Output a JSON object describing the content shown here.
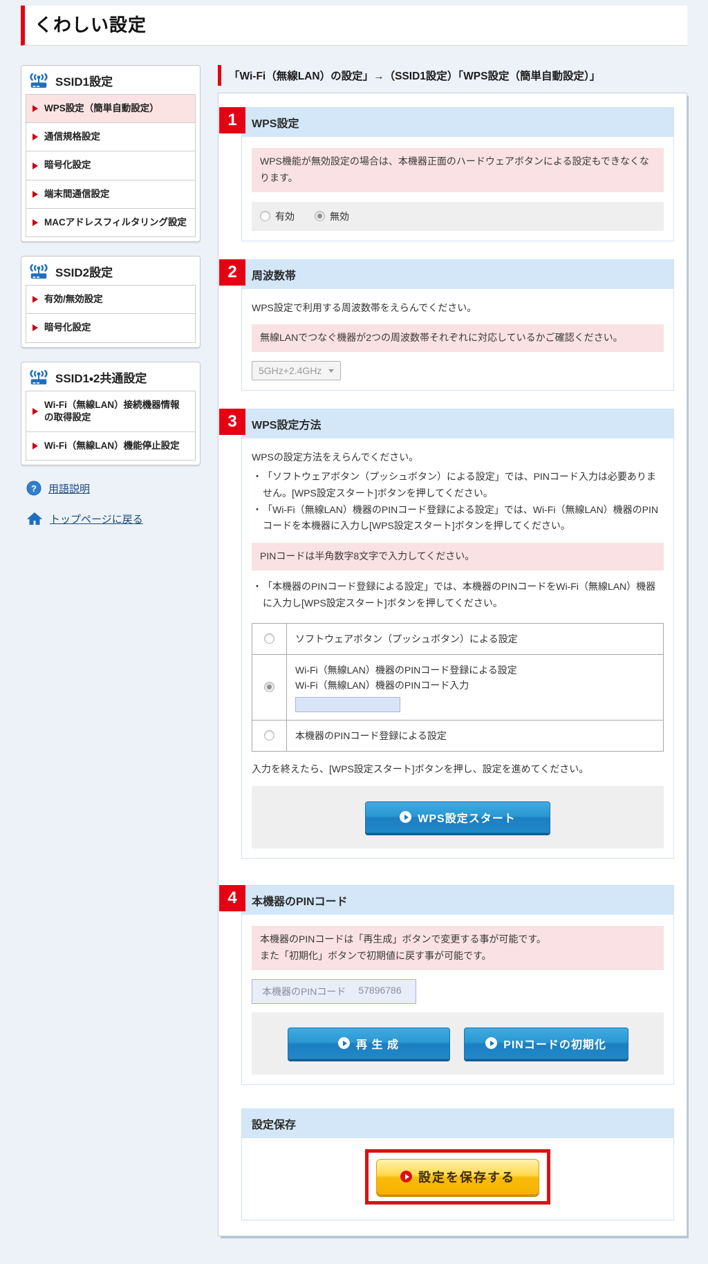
{
  "page": {
    "title": "くわしい設定"
  },
  "colors": {
    "accent_red": "#e60012",
    "header_blue_bg": "#d3e7f8",
    "note_pink_bg": "#fae1e3",
    "active_item_pink": "#fbe3e3",
    "button_blue": "#1b7fc1",
    "button_yellow": "#f6b300",
    "link_navy": "#1b4a7a",
    "icon_blue": "#1d6ec2"
  },
  "icons": [
    "router-wifi-icon",
    "question-icon",
    "home-icon",
    "play-icon",
    "chevron-down-icon",
    "red-arrow-icon"
  ],
  "sidebar": {
    "groups": [
      {
        "title": "SSID1設定",
        "items": [
          {
            "label": "WPS設定（簡単自動設定）",
            "active": true
          },
          {
            "label": "通信規格設定",
            "active": false
          },
          {
            "label": "暗号化設定",
            "active": false
          },
          {
            "label": "端末間通信設定",
            "active": false
          },
          {
            "label": "MACアドレスフィルタリング設定",
            "active": false
          }
        ]
      },
      {
        "title": "SSID2設定",
        "items": [
          {
            "label": "有効/無効設定",
            "active": false
          },
          {
            "label": "暗号化設定",
            "active": false
          }
        ]
      },
      {
        "title": "SSID1・2共通設定",
        "items": [
          {
            "label": "Wi-Fi（無線LAN）接続機器情報の取得設定",
            "active": false
          },
          {
            "label": "Wi-Fi（無線LAN）機能停止設定",
            "active": false
          }
        ]
      }
    ],
    "links": [
      {
        "label": "用語説明",
        "icon": "question-icon"
      },
      {
        "label": "トップページに戻る",
        "icon": "home-icon"
      }
    ]
  },
  "main": {
    "breadcrumb": "「Wi-Fi（無線LAN）の設定」→（SSID1設定）「WPS設定（簡単自動設定）」",
    "section1": {
      "number": "1",
      "title": "WPS設定",
      "note": "WPS機能が無効設定の場合は、本機器正面のハードウェアボタンによる設定もできなくなります。",
      "radios": [
        {
          "label": "有効",
          "checked": false
        },
        {
          "label": "無効",
          "checked": true
        }
      ]
    },
    "section2": {
      "number": "2",
      "title": "周波数帯",
      "desc": "WPS設定で利用する周波数帯をえらんでください。",
      "note": "無線LANでつなぐ機器が2つの周波数帯それぞれに対応しているかご確認ください。",
      "select_value": "5GHz+2.4GHz",
      "select_disabled": true
    },
    "section3": {
      "number": "3",
      "title": "WPS設定方法",
      "desc": "WPSの設定方法をえらんでください。",
      "bullet_marker": "・",
      "bullets": [
        "「ソフトウェアボタン（プッシュボタン）による設定」では、PINコード入力は必要ありません。[WPS設定スタート]ボタンを押してください。",
        "「Wi-Fi（無線LAN）機器のPINコード登録による設定」では、Wi-Fi（無線LAN）機器のPINコードを本機器に入力し[WPS設定スタート]ボタンを押してください。"
      ],
      "note": "PINコードは半角数字8文字で入力してください。",
      "bullet_after_note": "「本機器のPINコード登録による設定」では、本機器のPINコードをWi-Fi（無線LAN）機器に入力し[WPS設定スタート]ボタンを押してください。",
      "options": [
        {
          "label": "ソフトウェアボタン（プッシュボタン）による設定",
          "checked": false
        },
        {
          "label": "Wi-Fi（無線LAN）機器のPINコード登録による設定",
          "sublabel": "Wi-Fi（無線LAN）機器のPINコード入力",
          "input_value": "",
          "checked": true
        },
        {
          "label": "本機器のPINコード登録による設定",
          "checked": false
        }
      ],
      "footer": "入力を終えたら、[WPS設定スタート]ボタンを押し、設定を進めてください。",
      "start_button": "WPS設定スタート"
    },
    "section4": {
      "number": "4",
      "title": "本機器のPINコード",
      "note_line1": "本機器のPINコードは「再生成」ボタンで変更する事が可能です。",
      "note_line2": "また「初期化」ボタンで初期値に戻す事が可能です。",
      "pin_label": "本機器のPINコード",
      "pin_value": "57896786",
      "regen_button": "再 生 成",
      "init_button": "PINコードの初期化"
    },
    "save": {
      "title": "設定保存",
      "button": "設定を保存する"
    }
  }
}
